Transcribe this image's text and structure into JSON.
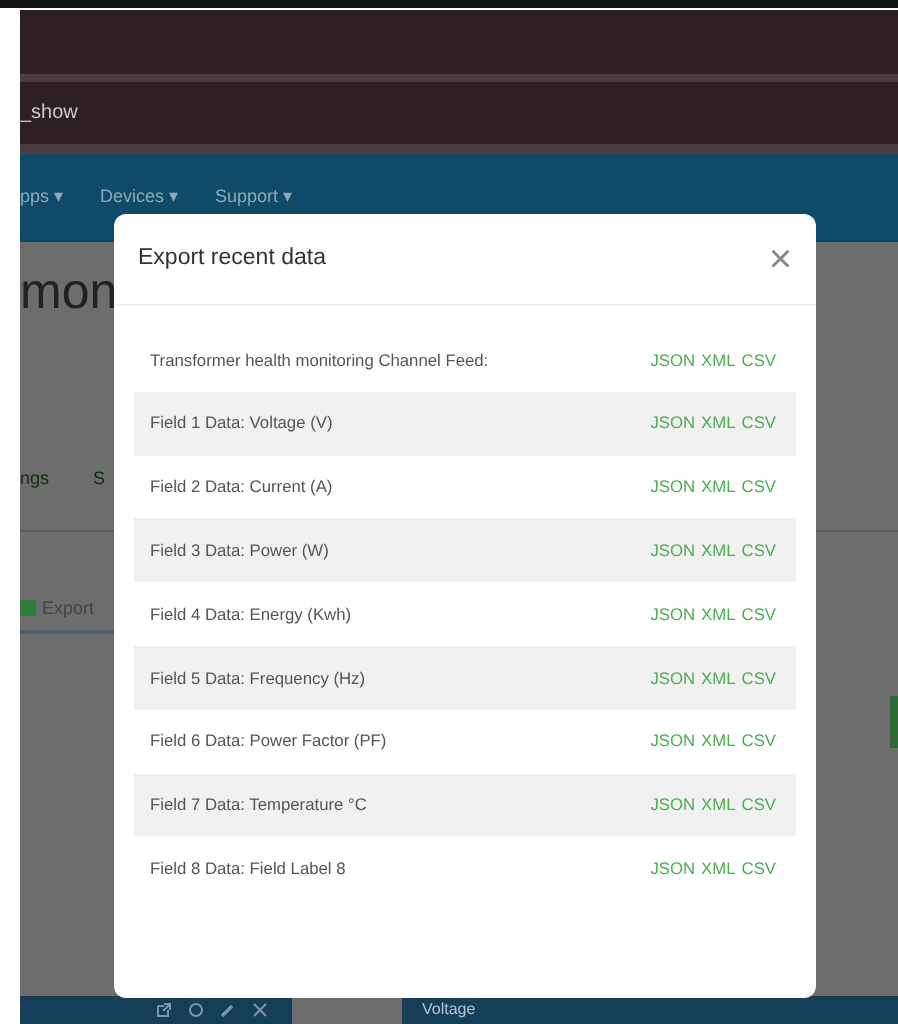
{
  "browser": {
    "tab_text": "_show"
  },
  "nav": {
    "items": [
      "pps ▾",
      "Devices ▾",
      "Support ▾"
    ]
  },
  "page": {
    "heading": "mon",
    "tabs": [
      "ngs",
      "S"
    ],
    "export_button": "Export"
  },
  "panels": [
    {
      "kind": "tools"
    },
    {
      "kind": "titled",
      "title": "Voltage"
    }
  ],
  "modal": {
    "title": "Export recent data",
    "close": "×",
    "rows": [
      {
        "label": "Transformer health monitoring Channel Feed:",
        "formats": [
          "JSON",
          "XML",
          "CSV"
        ]
      },
      {
        "label": "Field 1 Data: Voltage (V)",
        "formats": [
          "JSON",
          "XML",
          "CSV"
        ]
      },
      {
        "label": "Field 2 Data: Current (A)",
        "formats": [
          "JSON",
          "XML",
          "CSV"
        ]
      },
      {
        "label": "Field 3 Data: Power (W)",
        "formats": [
          "JSON",
          "XML",
          "CSV"
        ]
      },
      {
        "label": "Field 4 Data: Energy (Kwh)",
        "formats": [
          "JSON",
          "XML",
          "CSV"
        ]
      },
      {
        "label": "Field 5 Data: Frequency (Hz)",
        "formats": [
          "JSON",
          "XML",
          "CSV"
        ]
      },
      {
        "label": "Field 6 Data: Power Factor (PF)",
        "formats": [
          "JSON",
          "XML",
          "CSV"
        ]
      },
      {
        "label": "Field 7 Data: Temperature °C",
        "formats": [
          "JSON",
          "XML",
          "CSV"
        ]
      },
      {
        "label": "Field 8 Data: Field Label 8",
        "formats": [
          "JSON",
          "XML",
          "CSV"
        ]
      }
    ]
  }
}
